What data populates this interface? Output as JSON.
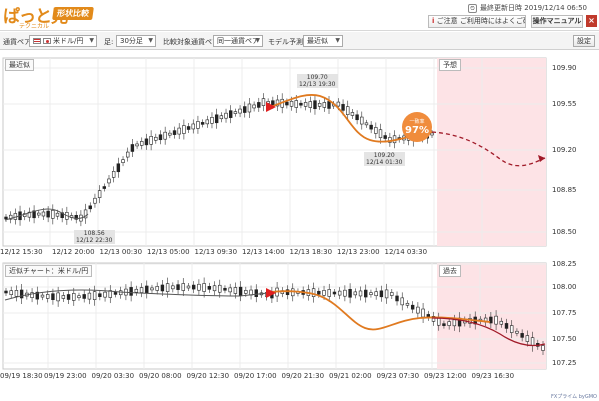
{
  "app": {
    "logo_text": "ぱっと見",
    "logo_sub": "テクニカル",
    "logo_badge": "形状比較",
    "updated_label": "最終更新日時",
    "updated_value": "2019/12/14 06:50",
    "caution_label": "ご注意",
    "caution_text": "ご利用時にはよくご確認ください",
    "manual_label": "操作マニュアル",
    "close_label": "×"
  },
  "toolbar": {
    "pair_label": "通貨ペア:",
    "pair_value": "米ドル/円",
    "timeframe_label": "足:",
    "timeframe_value": "30分足",
    "compare_label": "比較対象通貨ペア:",
    "compare_value": "同一通貨ペア",
    "model_label": "モデル予測:",
    "model_value": "最近似",
    "settings_label": "設定"
  },
  "top_chart": {
    "tag": "最近似",
    "forecast_tag": "予想",
    "match_label": "一致率",
    "match_value": "97%",
    "y_labels": [
      "109.90",
      "109.55",
      "109.20",
      "108.85",
      "108.50"
    ],
    "x_labels": [
      "12/12 15:30",
      "12/12 20:00",
      "12/13 00:30",
      "12/13 05:00",
      "12/13 09:30",
      "12/13 14:00",
      "12/13 18:30",
      "12/13 23:00",
      "12/14 03:30"
    ],
    "annot_low": {
      "price": "108.56",
      "time": "12/12 22:30"
    },
    "annot_high": {
      "price": "109.70",
      "time": "12/13 19:30"
    },
    "annot_low2": {
      "price": "109.20",
      "time": "12/14 01:30"
    }
  },
  "bottom_chart": {
    "tag": "近似チャート：米ドル/円",
    "past_tag": "過去",
    "y_labels": [
      "108.25",
      "108.00",
      "107.75",
      "107.50",
      "107.25"
    ],
    "x_labels": [
      "09/19 18:30",
      "09/19 23:00",
      "09/20 03:30",
      "09/20 08:00",
      "09/20 12:30",
      "09/20 17:00",
      "09/20 21:30",
      "09/21 02:00",
      "09/23 07:30",
      "09/23 12:00",
      "09/23 16:30"
    ],
    "footer": "FXプライム byGMO"
  },
  "colors": {
    "forecast_bg": "#fde3e6",
    "model_line": "#e07a20",
    "forecast_line": "#a01a28",
    "arrow": "#e02020"
  }
}
